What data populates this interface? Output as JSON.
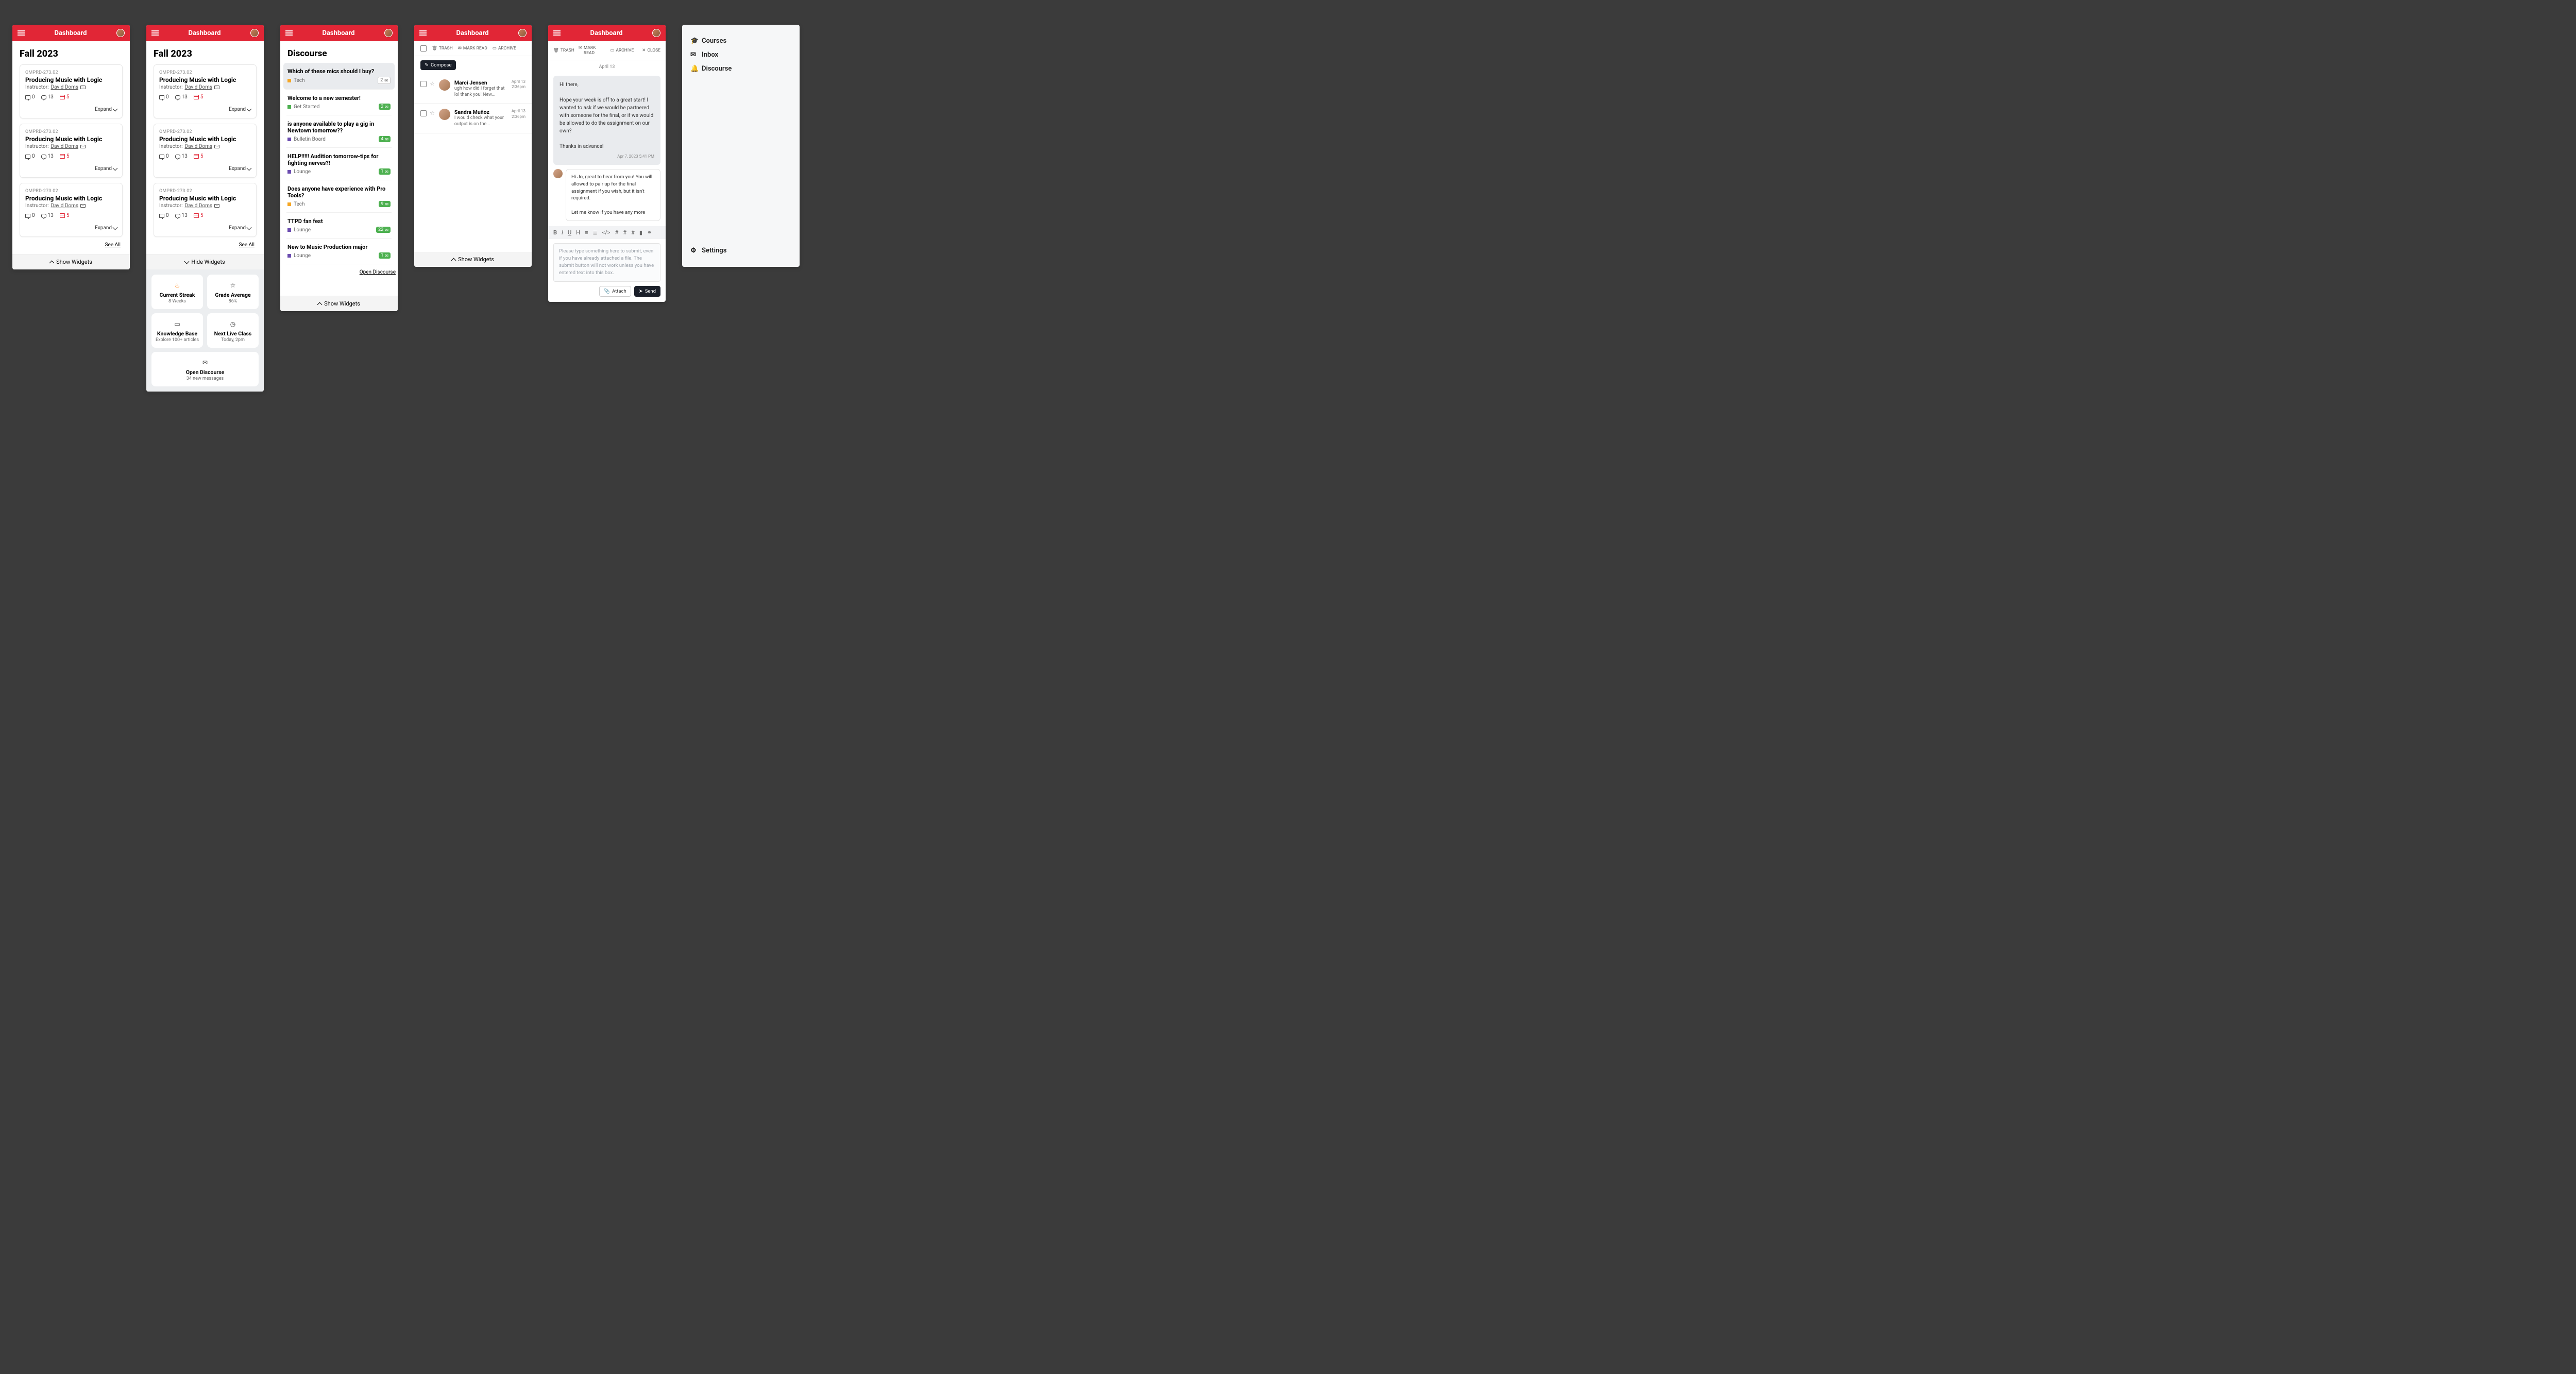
{
  "header": {
    "title": "Dashboard"
  },
  "term": "Fall 2023",
  "course": {
    "code": "OMPRD-273.02",
    "title": "Producing Music with Logic",
    "instructor_label": "Instructor:",
    "instructor": "David Doms",
    "stat_discussions": "0",
    "stat_comments": "13",
    "stat_assignments": "5",
    "expand": "Expand"
  },
  "see_all": "See All",
  "show_widgets": "Show Widgets",
  "hide_widgets": "Hide Widgets",
  "widgets": {
    "streak": {
      "title": "Current Streak",
      "sub": "8 Weeks"
    },
    "grade": {
      "title": "Grade Average",
      "sub": "86%"
    },
    "kb": {
      "title": "Knowledge Base",
      "sub": "Explore 100+ articles"
    },
    "live": {
      "title": "Next Live Class",
      "sub": "Today, 2pm"
    },
    "disc": {
      "title": "Open Discourse",
      "sub": "34 new messages"
    }
  },
  "discourse": {
    "heading": "Discourse",
    "open_link": "Open Discourse",
    "items": [
      {
        "title": "Which of these mics should I buy?",
        "cat": "Tech",
        "color": "orange",
        "count": "2",
        "style": "grey"
      },
      {
        "title": "Welcome to a new semester!",
        "cat": "Get Started",
        "color": "green",
        "count": "2",
        "style": "green"
      },
      {
        "title": "is anyone available to play a gig in Newtown tomorrow??",
        "cat": "Bulletin Board",
        "color": "purple",
        "count": "4",
        "style": "green"
      },
      {
        "title": "HELP!!!!! Audition tomorrow-tips for fighting nerves?!",
        "cat": "Lounge",
        "color": "purple",
        "count": "1",
        "style": "green"
      },
      {
        "title": "Does anyone have experience with Pro Tools?",
        "cat": "Tech",
        "color": "orange",
        "count": "9",
        "style": "green"
      },
      {
        "title": "TTPD fan fest",
        "cat": "Lounge",
        "color": "purple",
        "count": "22",
        "style": "green"
      },
      {
        "title": "New to Music Production major",
        "cat": "Lounge",
        "color": "purple",
        "count": "1",
        "style": "green"
      }
    ]
  },
  "inbox": {
    "toolbar": {
      "trash": "TRASH",
      "mark_read": "MARK READ",
      "archive": "ARCHIVE"
    },
    "compose": "Compose",
    "messages": [
      {
        "name": "Marci Jensen",
        "text": "ugh how did I forget that lol thank you! New...",
        "date": "April 13",
        "time": "2:36pm"
      },
      {
        "name": "Sandra Muñoz",
        "text": "I would check what your output is on the...",
        "date": "April 13",
        "time": "2:36pm"
      }
    ]
  },
  "thread": {
    "close": "CLOSE",
    "date_header": "April 13",
    "msg1": {
      "greet": "Hi there,",
      "body": "Hope your week is off to a great start! I wanted to ask if we would be partnered with someone for the final, or if we would be allowed to do the assignment on our own?",
      "thanks": "Thanks in advance!",
      "meta": "Apr 7, 2023 5:41 PM"
    },
    "reply": {
      "p1": "Hi Jo, great to hear from you! You will allowed to pair up for the final assignment if you wish, but it isn't required.",
      "p2": "Let me know if you have any more"
    },
    "placeholder": "Please type something here to submit, even if you have already attached a file. The submit button will not work unless you have entered text into this box.",
    "attach": "Attach",
    "send": "Send"
  },
  "menu": {
    "courses": "Courses",
    "inbox": "Inbox",
    "discourse": "Discourse",
    "settings": "Settings"
  }
}
